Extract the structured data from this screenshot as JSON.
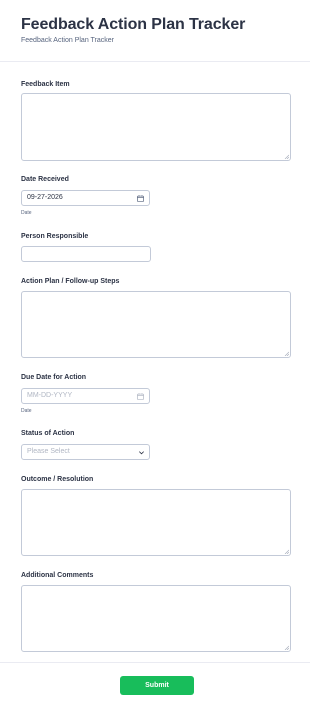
{
  "header": {
    "title": "Feedback Action Plan Tracker",
    "subtitle": "Feedback Action Plan Tracker"
  },
  "fields": {
    "feedback_item": {
      "label": "Feedback Item",
      "value": ""
    },
    "date_received": {
      "label": "Date Received",
      "value": "09-27-2026",
      "sublabel": "Date"
    },
    "person_responsible": {
      "label": "Person Responsible",
      "value": ""
    },
    "action_plan": {
      "label": "Action Plan / Follow-up Steps",
      "value": ""
    },
    "due_date": {
      "label": "Due Date for Action",
      "placeholder": "MM-DD-YYYY",
      "sublabel": "Date"
    },
    "status": {
      "label": "Status of Action",
      "selected": "Please Select"
    },
    "outcome": {
      "label": "Outcome / Resolution",
      "value": ""
    },
    "additional_comments": {
      "label": "Additional Comments",
      "value": ""
    }
  },
  "submit_label": "Submit",
  "colors": {
    "accent": "#18bd5b",
    "border": "#c3cad8",
    "text": "#2c3345",
    "muted": "#57647e"
  },
  "icons": {
    "date_received": "calendar-icon",
    "due_date": "calendar-icon",
    "status": "chevron-down-icon"
  }
}
